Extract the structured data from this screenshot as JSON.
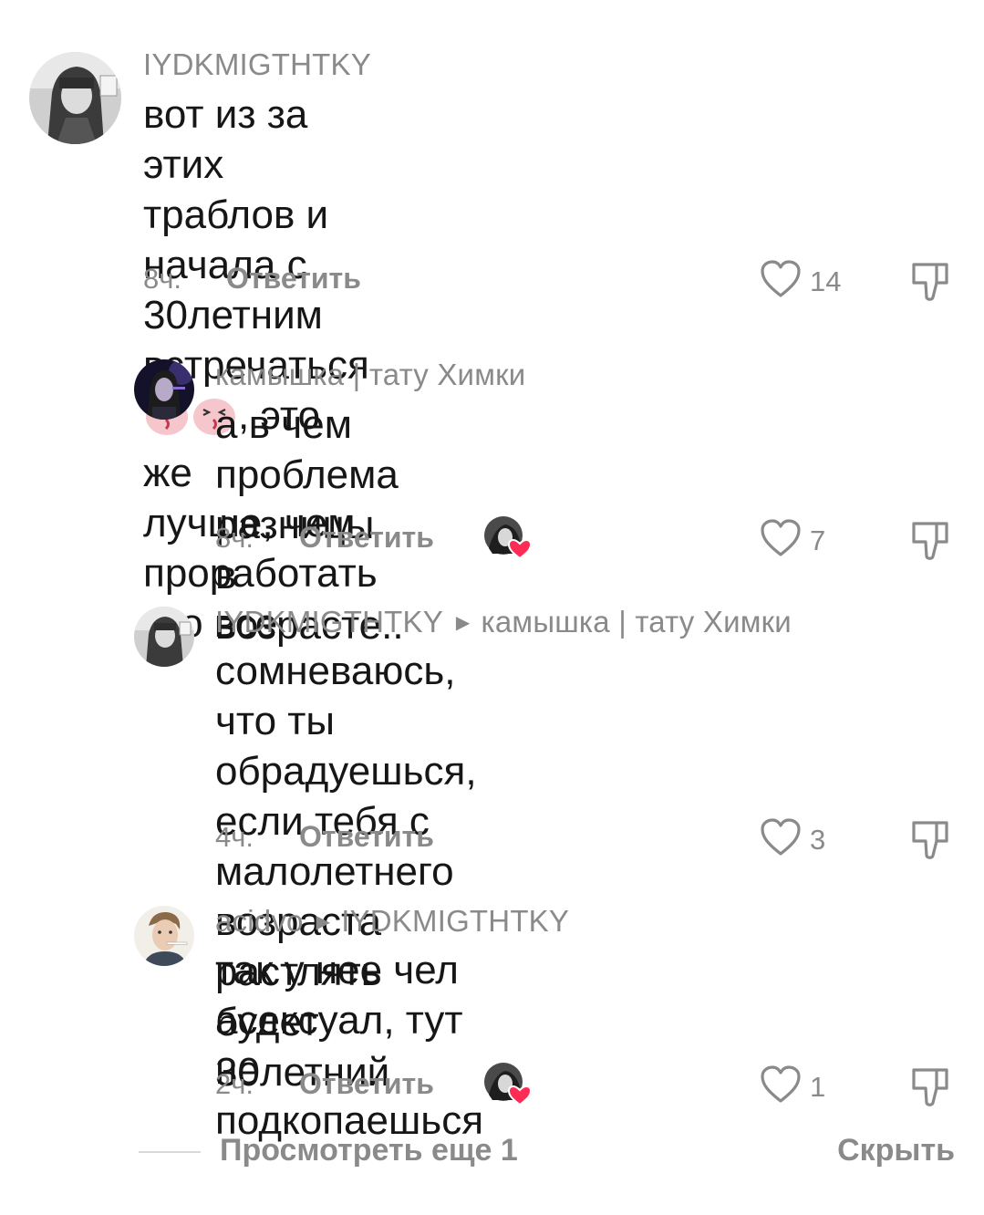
{
  "comments": [
    {
      "author": "IYDKMIGTHTKY",
      "reply_to": "",
      "text_lines": [
        "вот из за этих траблов и начала с",
        "30летним встречаться",
        ", это же",
        "лучше, чем проработать это все"
      ],
      "time": "8ч.",
      "reply_label": "Ответить",
      "likes": "14",
      "emojis": [
        "laughing-face-emoji",
        "laughing-face-emoji"
      ]
    },
    {
      "author": "камышка | тату Химки",
      "reply_to": "",
      "text": "а в чем проблема разницы в\nвозрасте..",
      "time": "8ч.",
      "reply_label": "Ответить",
      "likes": "7",
      "creator_liked": true
    },
    {
      "author": "IYDKMIGTHTKY",
      "reply_to": "камышка | тату Химки",
      "text": "сомневаюсь, что ты обрадуешься,\nесли тебя с малолетнего возраста\nрастлять будет 30летний",
      "time": "4ч.",
      "reply_label": "Ответить",
      "likes": "3"
    },
    {
      "author": "acidvo",
      "reply_to": "IYDKMIGTHTKY",
      "text": "так у нее чел асексуал, тут не\nподкопаешься",
      "time": "2ч.",
      "reply_label": "Ответить",
      "likes": "1",
      "creator_liked": true
    }
  ],
  "footer": {
    "view_more": "Просмотреть еще 1",
    "hide": "Скрыть"
  },
  "icons": {
    "like": "heart-outline-icon",
    "dislike": "thumbs-down-icon",
    "reply_arrow": "triangle-right-icon"
  },
  "colors": {
    "text": "#161616",
    "muted": "#8a8a8a",
    "creator_heart": "#fe2c55"
  }
}
